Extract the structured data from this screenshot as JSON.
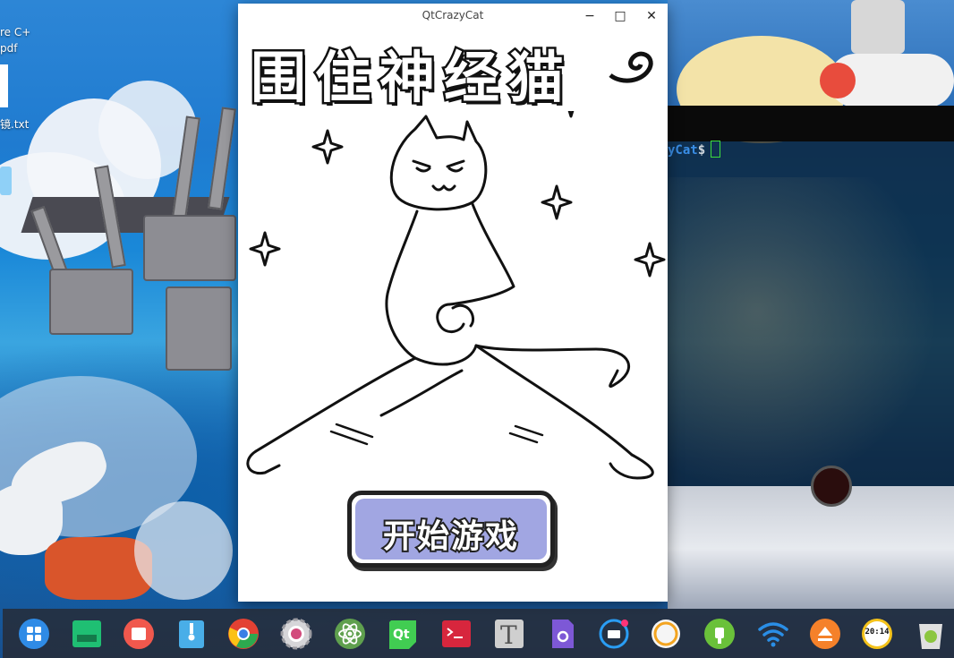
{
  "window": {
    "title": "QtCrazyCat",
    "minimize": "−",
    "maximize": "□",
    "close": "✕"
  },
  "game": {
    "title": "围住神经猫",
    "start_button": "开始游戏"
  },
  "desktop": {
    "files": [
      {
        "label": "re C+"
      },
      {
        "label": "pdf"
      },
      {
        "label": "镜.txt"
      }
    ]
  },
  "terminal": {
    "prompt_user": "yCat",
    "prompt_symbol": "$"
  },
  "dock": {
    "items": [
      {
        "name": "launcher-icon",
        "color": "#2f8be6"
      },
      {
        "name": "files-icon",
        "color": "#1fbf73"
      },
      {
        "name": "screenshot-icon",
        "color": "#f0584d"
      },
      {
        "name": "archive-icon",
        "color": "#49aee8"
      },
      {
        "name": "chrome-icon",
        "color": "#e34133"
      },
      {
        "name": "settings-icon",
        "color": "#d6d6d9"
      },
      {
        "name": "atom-icon",
        "color": "#5fa04e"
      },
      {
        "name": "qt-creator-icon",
        "color": "#41cd52"
      },
      {
        "name": "terminal-icon",
        "color": "#d7263d"
      },
      {
        "name": "text-editor-icon",
        "color": "#cfcfcf"
      },
      {
        "name": "system-tools-icon",
        "color": "#7d58d6"
      },
      {
        "name": "keyboard-icon",
        "color": "#2a9df4"
      },
      {
        "name": "power-icon",
        "color": "#f5f5f5"
      },
      {
        "name": "battery-icon",
        "color": "#6ac13a"
      },
      {
        "name": "wifi-icon",
        "color": "#2a8ee6"
      },
      {
        "name": "eject-icon",
        "color": "#f5812a"
      },
      {
        "name": "clock-icon",
        "color": "#f4c21a"
      },
      {
        "name": "trash-icon",
        "color": "#e0e0e0"
      }
    ],
    "clock_text": "20:14"
  }
}
